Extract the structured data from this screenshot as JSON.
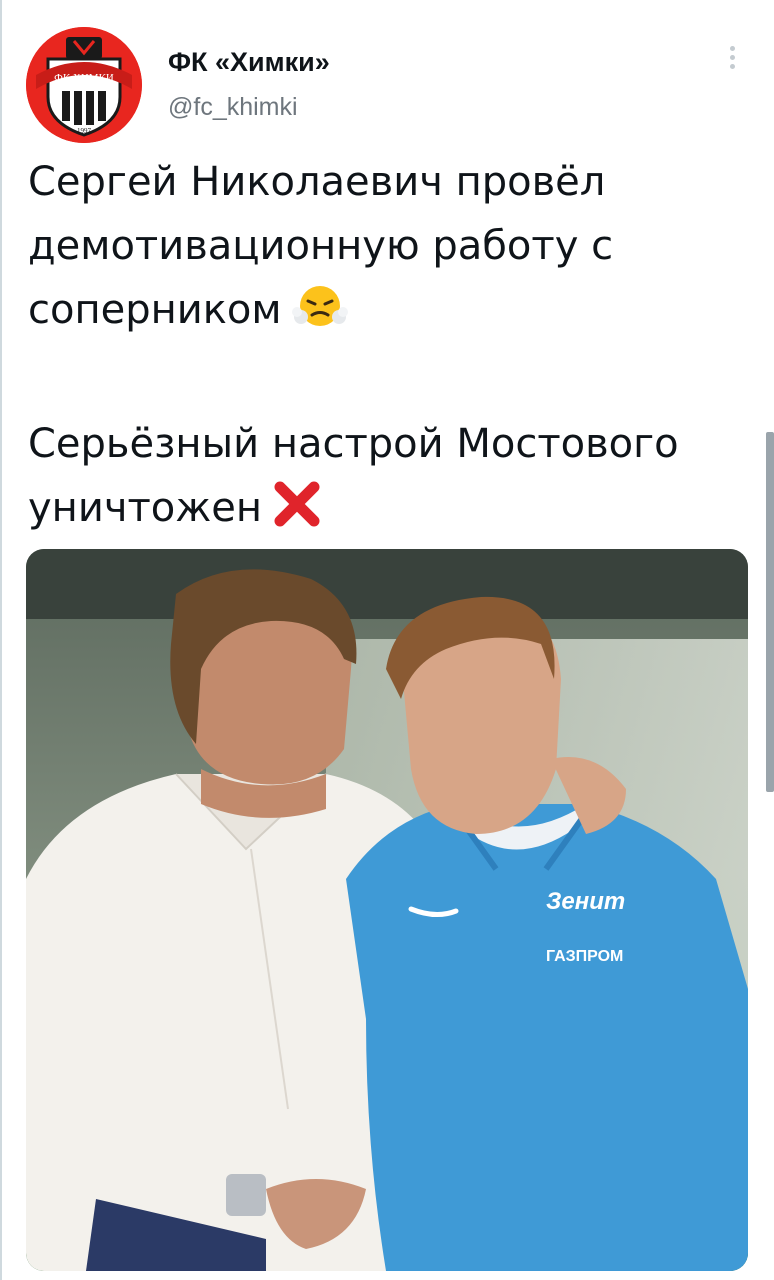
{
  "tweet": {
    "author": {
      "name": "ФК «Химки»",
      "handle": "@fc_khimki",
      "avatar_logo_text": "ФК ХИМКИ",
      "avatar_logo_year": "1997"
    },
    "text": {
      "line1": "Сергей Николаевич провёл",
      "line2": "демотивационную работу с",
      "line3": "соперником",
      "line5": "Серьёзный настрой Мостового",
      "line6": "уничтожен"
    },
    "emojis": [
      "face-with-steam-icon",
      "cross-mark-icon"
    ],
    "photo": {
      "jersey_logo_text": "Зенит",
      "jersey_sponsor_text": "ГАЗПРОМ"
    }
  },
  "colors": {
    "text": "#0f1419",
    "handle": "#6e767d",
    "avatar_red": "#e8261f",
    "jersey_blue": "#3f9ad6"
  }
}
